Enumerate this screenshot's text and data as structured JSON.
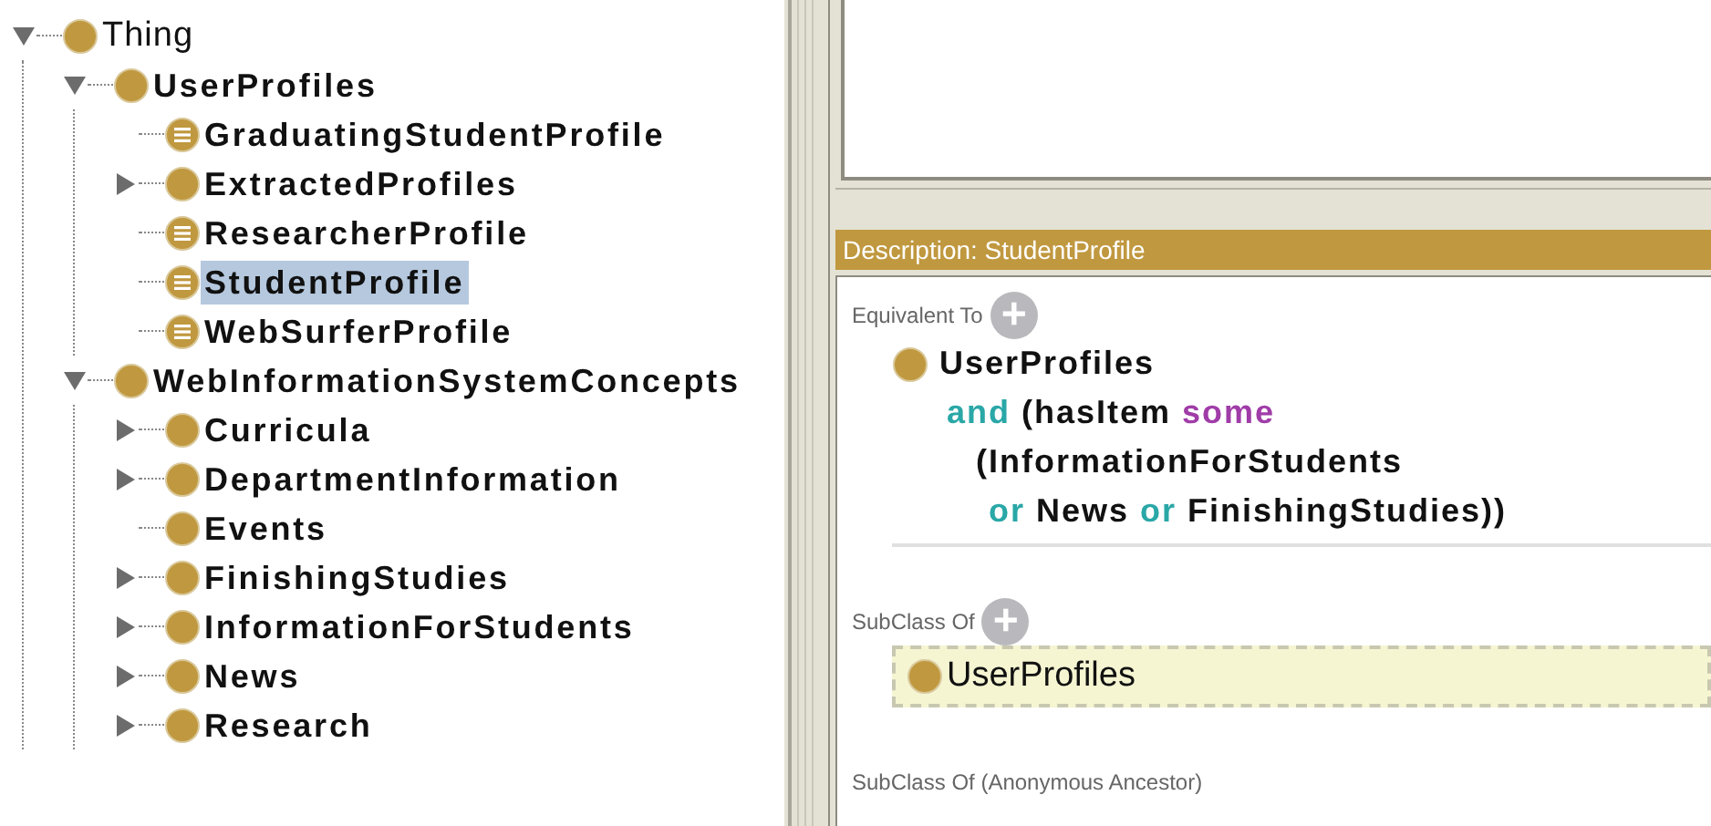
{
  "class_tree": [
    {
      "label": "Thing",
      "kind": "root",
      "expanded": true,
      "selected": false,
      "children": [
        {
          "label": "UserProfiles",
          "kind": "class",
          "expanded": true,
          "selected": false,
          "children": [
            {
              "label": "GraduatingStudentProfile",
              "kind": "defined",
              "selected": false
            },
            {
              "label": "ExtractedProfiles",
              "kind": "class",
              "expanded": false,
              "selected": false
            },
            {
              "label": "ResearcherProfile",
              "kind": "defined",
              "selected": false
            },
            {
              "label": "StudentProfile",
              "kind": "defined",
              "selected": true
            },
            {
              "label": "WebSurferProfile",
              "kind": "defined",
              "selected": false
            }
          ]
        },
        {
          "label": "WebInformationSystemConcepts",
          "kind": "class",
          "expanded": true,
          "selected": false,
          "children": [
            {
              "label": "Curricula",
              "kind": "class",
              "expanded": false,
              "selected": false
            },
            {
              "label": "DepartmentInformation",
              "kind": "class",
              "expanded": false,
              "selected": false
            },
            {
              "label": "Events",
              "kind": "class",
              "selected": false
            },
            {
              "label": "FinishingStudies",
              "kind": "class",
              "expanded": false,
              "selected": false
            },
            {
              "label": "InformationForStudents",
              "kind": "class",
              "expanded": false,
              "selected": false
            },
            {
              "label": "News",
              "kind": "class",
              "expanded": false,
              "selected": false
            },
            {
              "label": "Research",
              "kind": "class",
              "expanded": false,
              "selected": false
            }
          ]
        }
      ]
    }
  ],
  "description": {
    "title": "Description: StudentProfile",
    "sections": [
      {
        "label": "Equivalent To",
        "add_button": "+",
        "items": [
          {
            "kind": "expression",
            "selected": false,
            "lines": [
              {
                "icon": true,
                "tokens": [
                  {
                    "text": "UserProfiles",
                    "kind": "entity"
                  }
                ]
              },
              {
                "icon": false,
                "tokens": [
                  {
                    "text": "and",
                    "kind": "logic"
                  },
                  {
                    "text": "(hasItem",
                    "kind": "entity"
                  },
                  {
                    "text": "some",
                    "kind": "quantifier"
                  }
                ]
              },
              {
                "icon": false,
                "tokens": [
                  {
                    "text": "(InformationForStudents",
                    "kind": "entity"
                  }
                ]
              },
              {
                "icon": false,
                "tokens": [
                  {
                    "text": "or",
                    "kind": "logic"
                  },
                  {
                    "text": "News",
                    "kind": "entity"
                  },
                  {
                    "text": "or",
                    "kind": "logic"
                  },
                  {
                    "text": "FinishingStudies))",
                    "kind": "entity"
                  }
                ]
              }
            ]
          }
        ]
      },
      {
        "label": "SubClass Of",
        "add_button": "+",
        "items": [
          {
            "kind": "class",
            "label": "UserProfiles",
            "selected": true
          }
        ]
      },
      {
        "label": "SubClass Of (Anonymous Ancestor)"
      }
    ]
  }
}
